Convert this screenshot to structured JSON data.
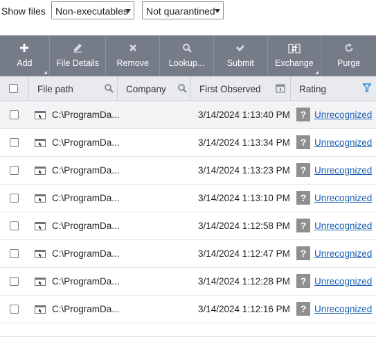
{
  "filters": {
    "label": "Show files",
    "file_type": "Non-executables",
    "quarantine": "Not quarantined"
  },
  "toolbar": [
    {
      "label": "Add",
      "icon": "plus-icon"
    },
    {
      "label": "File Details",
      "icon": "pencil-icon"
    },
    {
      "label": "Remove",
      "icon": "x-icon"
    },
    {
      "label": "Lookup...",
      "icon": "search-icon"
    },
    {
      "label": "Submit",
      "icon": "checkmark-icon"
    },
    {
      "label": "Exchange",
      "icon": "exchange-icon"
    },
    {
      "label": "Purge",
      "icon": "refresh-icon"
    }
  ],
  "table": {
    "columns": {
      "file_path": "File path",
      "company": "Company",
      "first_observed": "First Observed",
      "rating": "Rating"
    },
    "rows": [
      {
        "path": "C:\\ProgramDa...",
        "company": "",
        "first_observed": "3/14/2024 1:13:40 PM",
        "rating": "Unrecognized"
      },
      {
        "path": "C:\\ProgramDa...",
        "company": "",
        "first_observed": "3/14/2024 1:13:34 PM",
        "rating": "Unrecognized"
      },
      {
        "path": "C:\\ProgramDa...",
        "company": "",
        "first_observed": "3/14/2024 1:13:23 PM",
        "rating": "Unrecognized"
      },
      {
        "path": "C:\\ProgramDa...",
        "company": "",
        "first_observed": "3/14/2024 1:13:10 PM",
        "rating": "Unrecognized"
      },
      {
        "path": "C:\\ProgramDa...",
        "company": "",
        "first_observed": "3/14/2024 1:12:58 PM",
        "rating": "Unrecognized"
      },
      {
        "path": "C:\\ProgramDa...",
        "company": "",
        "first_observed": "3/14/2024 1:12:47 PM",
        "rating": "Unrecognized"
      },
      {
        "path": "C:\\ProgramDa...",
        "company": "",
        "first_observed": "3/14/2024 1:12:28 PM",
        "rating": "Unrecognized"
      },
      {
        "path": "C:\\ProgramDa...",
        "company": "",
        "first_observed": "3/14/2024 1:12:16 PM",
        "rating": "Unrecognized"
      }
    ]
  },
  "rating_badge": "?",
  "colors": {
    "toolbar_bg": "#767b88",
    "header_bg": "#e9eaee",
    "link": "#1b5fb3",
    "filter_icon": "#2b7fd6",
    "badge_bg": "#8f8f8f"
  }
}
